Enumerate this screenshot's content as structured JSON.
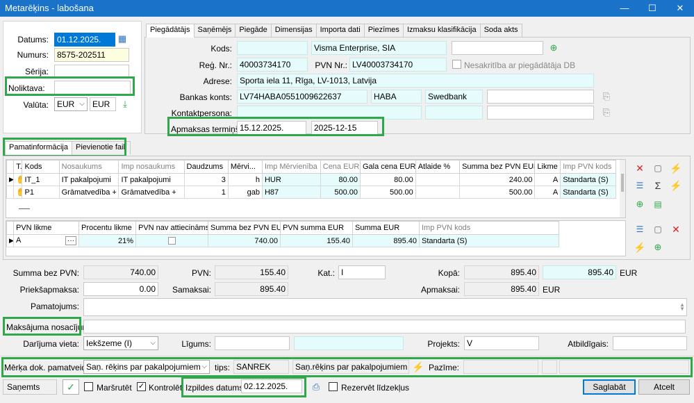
{
  "window": {
    "title": "Metarēķins - labošana",
    "min": "—",
    "max": "☐",
    "close": "✕"
  },
  "header": {
    "datums_label": "Datums:",
    "datums_value": "01.12.2025.",
    "numurs_label": "Numurs:",
    "numurs_value": "8575-202511",
    "serija_label": "Sērija:",
    "serija_value": "",
    "noliktava_label": "Noliktava:",
    "noliktava_value": "",
    "valuta_label": "Valūta:",
    "valuta_value": "EUR",
    "valuta_code": "EUR"
  },
  "top_tabs": [
    "Piegādātājs",
    "Saņēmējs",
    "Piegāde",
    "Dimensijas",
    "Importa dati",
    "Piezīmes",
    "Izmaksu klasifikācija",
    "Soda akts"
  ],
  "supplier": {
    "kods_label": "Kods:",
    "kods_value": "",
    "name_value": "Visma Enterprise, SIA",
    "extra_value": "",
    "reg_label": "Reģ. Nr.:",
    "reg_value": "40003734170",
    "pvn_label": "PVN Nr.:",
    "pvn_value": "LV40003734170",
    "nesakritiba_label": "Nesakritība ar piegādātāja DB",
    "adrese_label": "Adrese:",
    "adrese_value": "Sporta iela 11, Rīga, LV-1013, Latvija",
    "banka_label": "Bankas konts:",
    "banka_value": "LV74HABA0551009622637",
    "banka_code": "HABA",
    "banka_name": "Swedbank",
    "kontakt_label": "Kontaktpersona:",
    "termins_label": "Apmaksas termiņš:",
    "termins_value": "15.12.2025.",
    "termins_iso": "2025-12-15"
  },
  "mid_tabs": [
    "Pamatinformācija",
    "Pievienotie faili"
  ],
  "lines": {
    "headers": [
      "T..",
      "Kods",
      "Nosaukums",
      "Imp nosaukums",
      "Daudzums",
      "Mērvi...",
      "Imp Mērvienība",
      "Cena EUR",
      "Gala cena EUR",
      "Atlaide %",
      "Summa bez PVN EUR",
      "Likme",
      "Imp PVN kods"
    ],
    "rows": [
      [
        "IT_1",
        "IT pakalpojumi",
        "IT pakalpojumi",
        "3",
        "h",
        "HUR",
        "80.00",
        "80.00",
        "",
        "240.00",
        "A",
        "Standarta (S)"
      ],
      [
        "P1",
        "Grāmatvedība +",
        "Grāmatvedība +",
        "1",
        "gab",
        "H87",
        "500.00",
        "500.00",
        "",
        "500.00",
        "A",
        "Standarta (S)"
      ]
    ]
  },
  "vat": {
    "headers": [
      "PVN likme",
      "Procentu likme",
      "PVN nav attiecināms",
      "Summa bez PVN EUR",
      "PVN summa EUR",
      "Summa EUR",
      "Imp PVN kods"
    ],
    "row": [
      "A",
      "21%",
      "",
      "740.00",
      "155.40",
      "895.40",
      "Standarta (S)"
    ]
  },
  "totals": {
    "summa_label": "Summa bez PVN:",
    "summa_value": "740.00",
    "pvn_label": "PVN:",
    "pvn_value": "155.40",
    "kat_label": "Kat.:",
    "kat_value": "I",
    "kopa_label": "Kopā:",
    "kopa_value": "895.40",
    "kopa_value2": "895.40",
    "kopa_cur": "EUR",
    "prieksapm_label": "Priekšapmaksa:",
    "prieksapm_value": "0.00",
    "samaksai_label": "Samaksai:",
    "samaksai_value": "895.40",
    "apmaksai_label": "Apmaksai:",
    "apmaksai_value": "895.40",
    "apmaksai_cur": "EUR",
    "pamatojums_label": "Pamatojums:",
    "maksajuma_label": "Maksājuma nosacījumi:",
    "darijuma_label": "Darījuma vieta:",
    "darijuma_value": "Iekšzeme (I)",
    "ligums_label": "Līgums:",
    "projekts_label": "Projekts:",
    "projekts_value": "V",
    "atbildigais_label": "Atbildīgais:"
  },
  "target": {
    "label": "Mērķa dok. pamatveids:",
    "value": "Saņ. rēķins par pakalpojumiem",
    "tips_label": "tips:",
    "tips_value": "SANREK",
    "tips_name": "Saņ.rēķins par pakalpojumiem",
    "pazime_label": "Pazīme:"
  },
  "footer": {
    "status": "Saņemts",
    "marsrutet": "Maršrutēt",
    "kontrolet": "Kontrolēt",
    "izpildes_label": "Izpildes datums:",
    "izpildes_value": "02.12.2025.",
    "rezervet": "Rezervēt līdzekļus",
    "save": "Saglabāt",
    "cancel": "Atcelt"
  }
}
